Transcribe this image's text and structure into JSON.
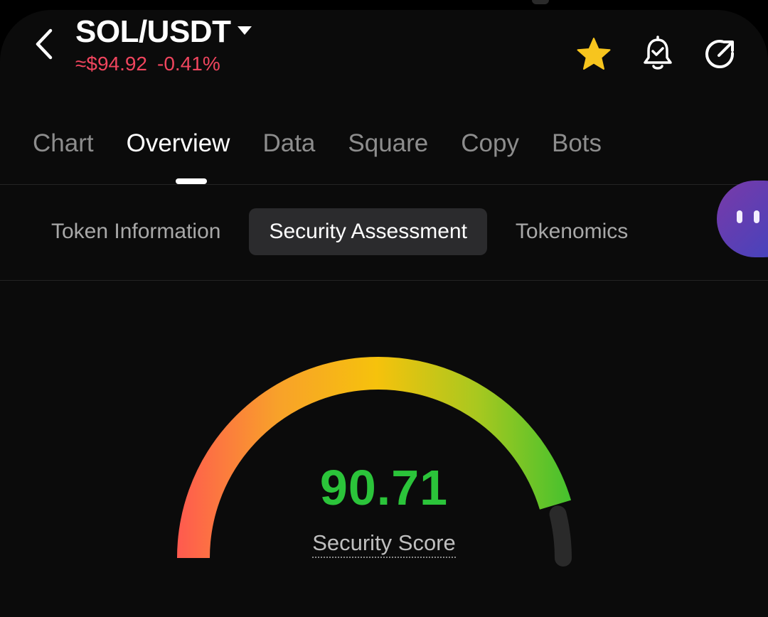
{
  "header": {
    "pair": "SOL/USDT",
    "price": "≈$94.92",
    "change": "-0.41%",
    "colors": {
      "negative": "#f0455e",
      "favorite": "#f7c51e"
    },
    "icons": [
      "back-arrow-icon",
      "dropdown-caret-icon",
      "star-icon",
      "alarm-bell-icon",
      "share-icon"
    ]
  },
  "main_tabs": [
    {
      "label": "Chart"
    },
    {
      "label": "Overview",
      "active": true
    },
    {
      "label": "Data"
    },
    {
      "label": "Square"
    },
    {
      "label": "Copy"
    },
    {
      "label": "Bots"
    }
  ],
  "sub_tabs": [
    {
      "label": "Token Information"
    },
    {
      "label": "Security Assessment",
      "active": true
    },
    {
      "label": "Tokenomics"
    }
  ],
  "security": {
    "score": "90.71",
    "score_fraction": 0.9071,
    "label": "Security Score",
    "score_color": "#2bc43a",
    "gauge_colors": [
      "#ff5a4f",
      "#f8a12a",
      "#f6c20c",
      "#a9c81f",
      "#3fc12f"
    ]
  }
}
